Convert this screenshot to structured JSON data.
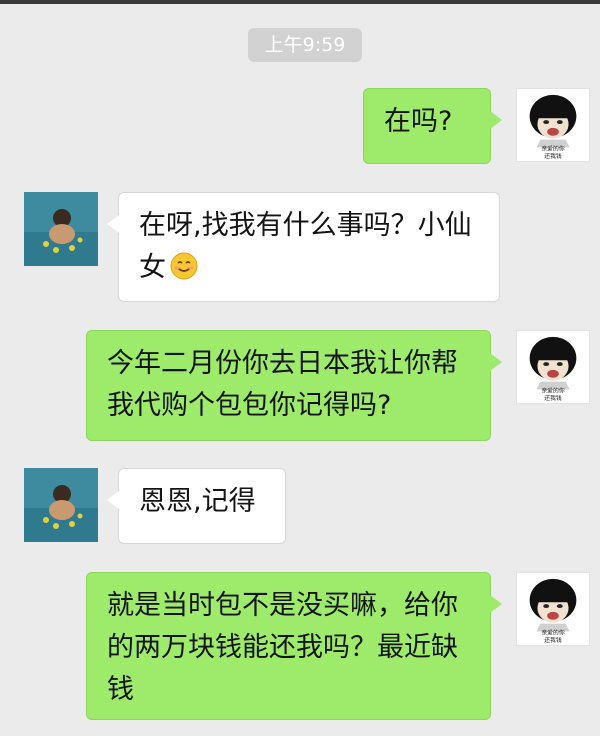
{
  "chat": {
    "timestamp": "上午9:59",
    "messages": [
      {
        "sender": "me",
        "text": "在吗?"
      },
      {
        "sender": "friend",
        "text": "在呀,找我有什么事吗？小仙女",
        "emoji": "smiling-face-emoji"
      },
      {
        "sender": "me",
        "text": "今年二月份你去日本我让你帮我代购个包包你记得吗?"
      },
      {
        "sender": "friend",
        "text": "恩恩,记得"
      },
      {
        "sender": "me",
        "text": "就是当时包不是没买嘛，给你的两万块钱能还我吗？最近缺钱"
      }
    ],
    "me_avatar_caption": [
      "亲爱的你",
      "还我钱"
    ]
  },
  "colors": {
    "background": "#ebebeb",
    "my_bubble": "#9eea6a",
    "friend_bubble": "#ffffff",
    "timestamp_bg": "#d2d2d2"
  }
}
